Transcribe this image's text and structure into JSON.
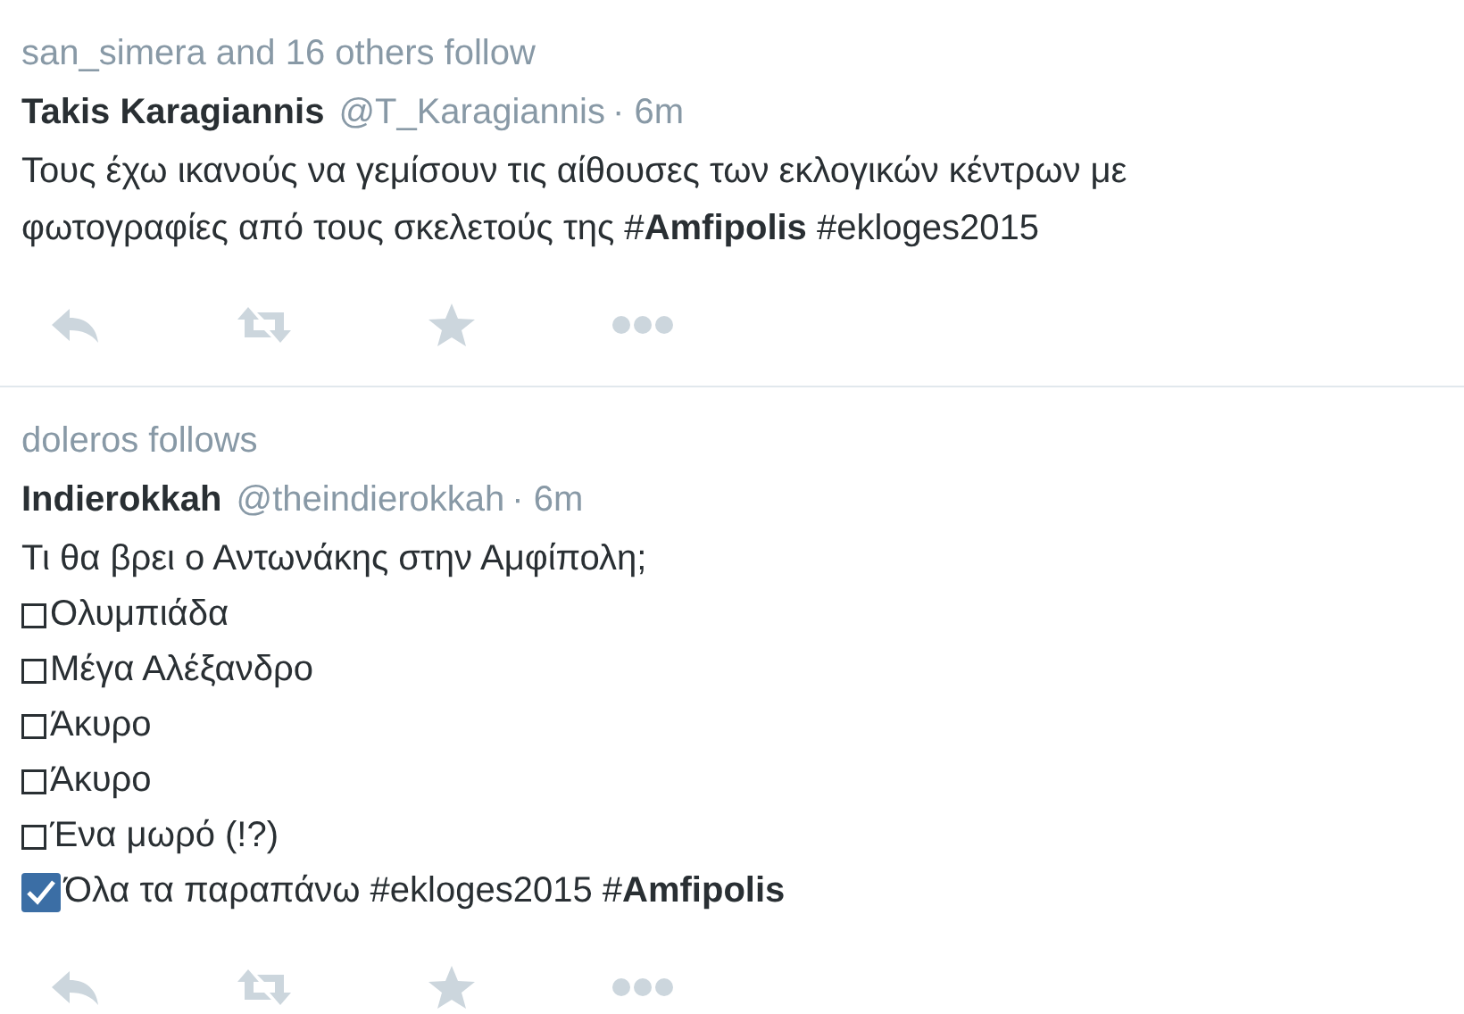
{
  "tweets": [
    {
      "context": "san_simera and 16 others follow",
      "name": "Takis Karagiannis",
      "handle": "@T_Karagiannis",
      "time": "· 6m",
      "lines": [
        "Τους έχω ικανούς να γεμίσουν τις αίθουσες των εκλογικών κέντρων με",
        "φωτογραφίες από τους σκελετούς της #**Amfipolis** #ekloges2015"
      ]
    },
    {
      "context": "doleros follows",
      "name": "Indierokkah",
      "handle": "@theindierokkah",
      "time": "· 6m",
      "lines": [
        "Τι θα βρει ο Αντωνάκης στην Αμφίπολη;"
      ],
      "options": [
        {
          "text": "Ολυμπιάδα",
          "checked": false
        },
        {
          "text": "Μέγα Αλέξανδρο",
          "checked": false
        },
        {
          "text": "Άκυρο",
          "checked": false
        },
        {
          "text": "Άκυρο",
          "checked": false
        },
        {
          "text": "Ένα μωρό (!?)",
          "checked": false
        },
        {
          "text": "Όλα τα παραπάνω #ekloges2015 #**Amfipolis**",
          "checked": true
        }
      ]
    }
  ]
}
